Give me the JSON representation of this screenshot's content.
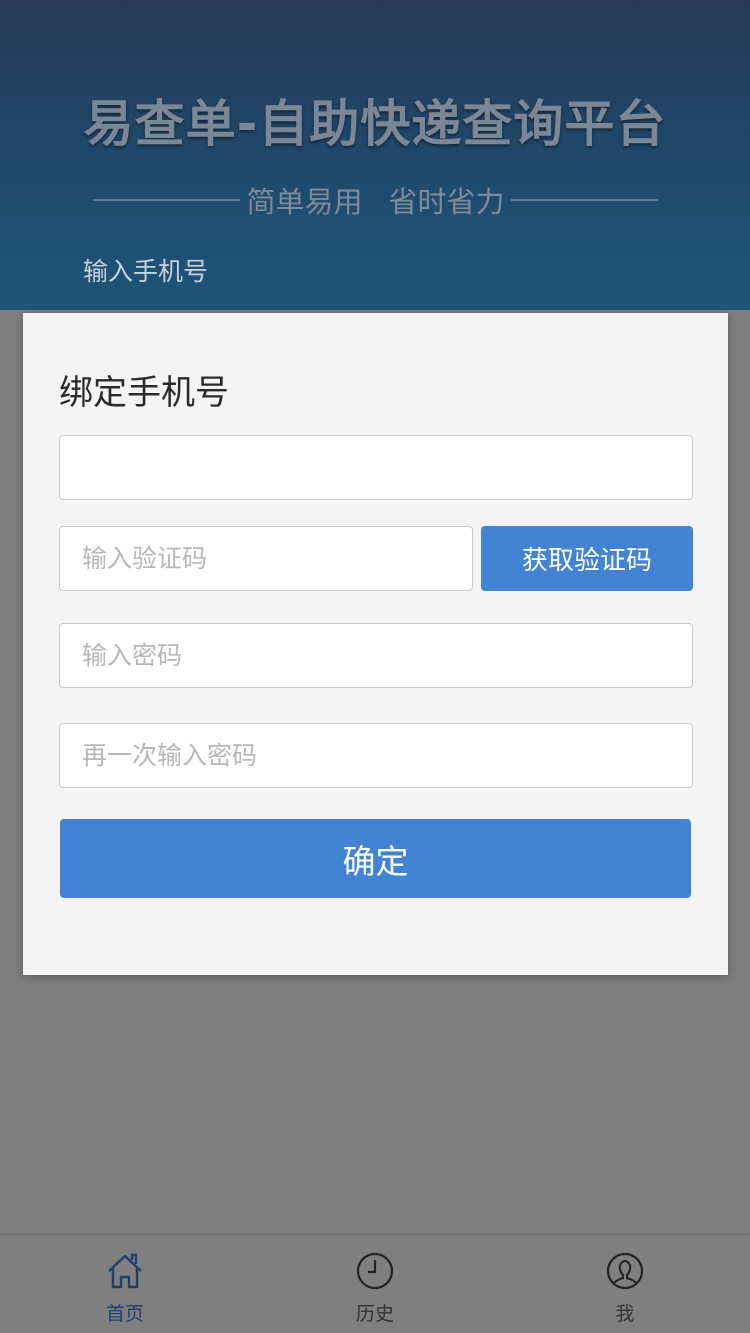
{
  "banner": {
    "title": "易查单-自助快递查询平台",
    "subtitle_left": "简单易用",
    "subtitle_right": "省时省力",
    "phone_label": "输入手机号"
  },
  "modal": {
    "title": "绑定手机号",
    "phone_value": "",
    "code_placeholder": "输入验证码",
    "get_code_label": "获取验证码",
    "password_placeholder": "输入密码",
    "password_confirm_placeholder": "再一次输入密码",
    "confirm_label": "确定"
  },
  "tabbar": {
    "items": [
      {
        "label": "首页",
        "icon": "home-icon",
        "active": true
      },
      {
        "label": "历史",
        "icon": "clock-icon",
        "active": false
      },
      {
        "label": "我",
        "icon": "user-icon",
        "active": false
      }
    ]
  },
  "colors": {
    "accent": "#4284d3",
    "banner_top": "#263a57",
    "banner_bottom": "#1d5579",
    "overlay": "#7d7d7d",
    "active_tab": "#1e3f6d"
  }
}
